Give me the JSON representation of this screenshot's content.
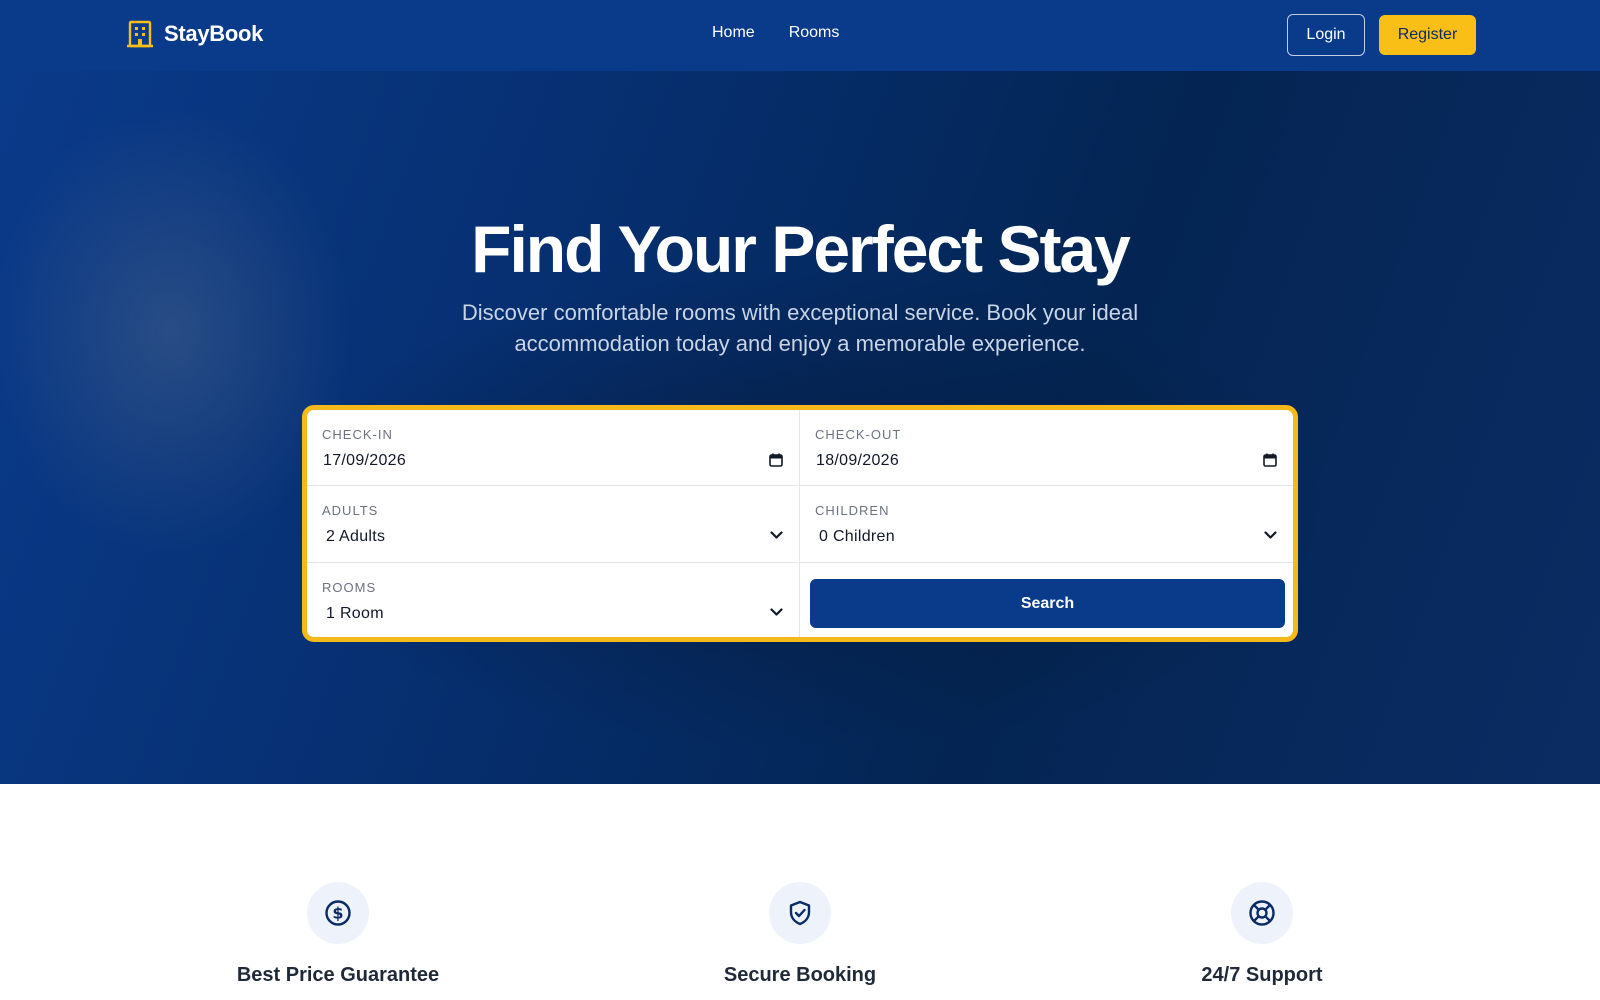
{
  "navbar": {
    "brand": "StayBook",
    "links": [
      {
        "label": "Home"
      },
      {
        "label": "Rooms"
      }
    ],
    "login_label": "Login",
    "register_label": "Register"
  },
  "hero": {
    "title": "Find Your Perfect Stay",
    "subtitle": "Discover comfortable rooms with exceptional service. Book your ideal accommodation today and enjoy a memorable experience."
  },
  "search": {
    "checkin": {
      "label": "CHECK-IN",
      "value": "17/09/2026"
    },
    "checkout": {
      "label": "CHECK-OUT",
      "value": "18/09/2026"
    },
    "adults": {
      "label": "ADULTS",
      "value": "2 Adults"
    },
    "children": {
      "label": "CHILDREN",
      "value": "0 Children"
    },
    "rooms": {
      "label": "ROOMS",
      "value": "1 Room"
    },
    "button_label": "Search"
  },
  "features": [
    {
      "title": "Best Price Guarantee",
      "icon": "dollar-icon"
    },
    {
      "title": "Secure Booking",
      "icon": "shield-check-icon"
    },
    {
      "title": "24/7 Support",
      "icon": "lifebuoy-icon"
    }
  ],
  "colors": {
    "primary": "#0a3a8a",
    "accent": "#f9bf16",
    "card_border": "#f5b91a"
  }
}
